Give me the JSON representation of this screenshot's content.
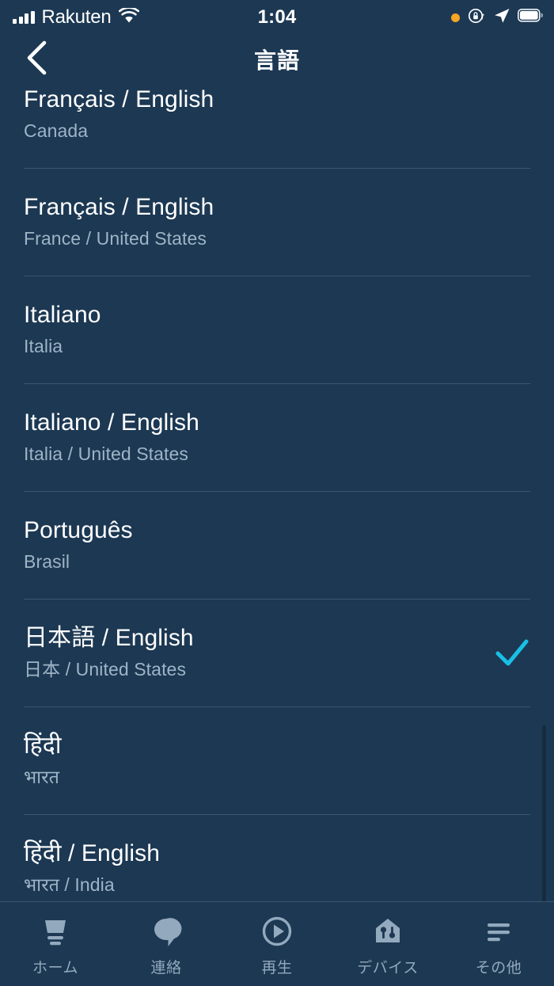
{
  "status_bar": {
    "carrier": "Rakuten",
    "time": "1:04",
    "icons": {
      "signal": "signal-bars-icon",
      "wifi": "wifi-icon",
      "recording_dot": "orange-recording-dot-icon",
      "orientation_lock": "orientation-lock-icon",
      "location": "location-arrow-icon",
      "battery": "battery-icon"
    }
  },
  "nav": {
    "title": "言語",
    "back_icon": "chevron-left-icon"
  },
  "colors": {
    "background": "#1c3853",
    "divider": "#3a5770",
    "title_text": "#ffffff",
    "subtitle_text": "#9fb4c6",
    "accent_check": "#19bfe5",
    "tab_inactive": "#93a9bd",
    "scrollbar": "#152b40",
    "status_orange": "#f5a623"
  },
  "language_list": [
    {
      "title": "Français / English",
      "subtitle": "Canada",
      "selected": false,
      "clipped": true
    },
    {
      "title": "Français / English",
      "subtitle": "France / United States",
      "selected": false,
      "clipped": false
    },
    {
      "title": "Italiano",
      "subtitle": "Italia",
      "selected": false,
      "clipped": false
    },
    {
      "title": "Italiano / English",
      "subtitle": "Italia / United States",
      "selected": false,
      "clipped": false
    },
    {
      "title": "Português",
      "subtitle": "Brasil",
      "selected": false,
      "clipped": false
    },
    {
      "title": "日本語 / English",
      "subtitle": "日本 / United States",
      "selected": true,
      "clipped": false
    },
    {
      "title": "हिंदी",
      "subtitle": "भारत",
      "selected": false,
      "clipped": false
    },
    {
      "title": "हिंदी / English",
      "subtitle": "भारत / India",
      "selected": false,
      "clipped": false
    }
  ],
  "tabbar": [
    {
      "label": "ホーム",
      "icon": "home-echo-icon",
      "active": false
    },
    {
      "label": "連絡",
      "icon": "speech-bubble-icon",
      "active": false
    },
    {
      "label": "再生",
      "icon": "play-circle-icon",
      "active": false
    },
    {
      "label": "デバイス",
      "icon": "devices-house-icon",
      "active": false
    },
    {
      "label": "その他",
      "icon": "more-hamburger-icon",
      "active": false
    }
  ]
}
